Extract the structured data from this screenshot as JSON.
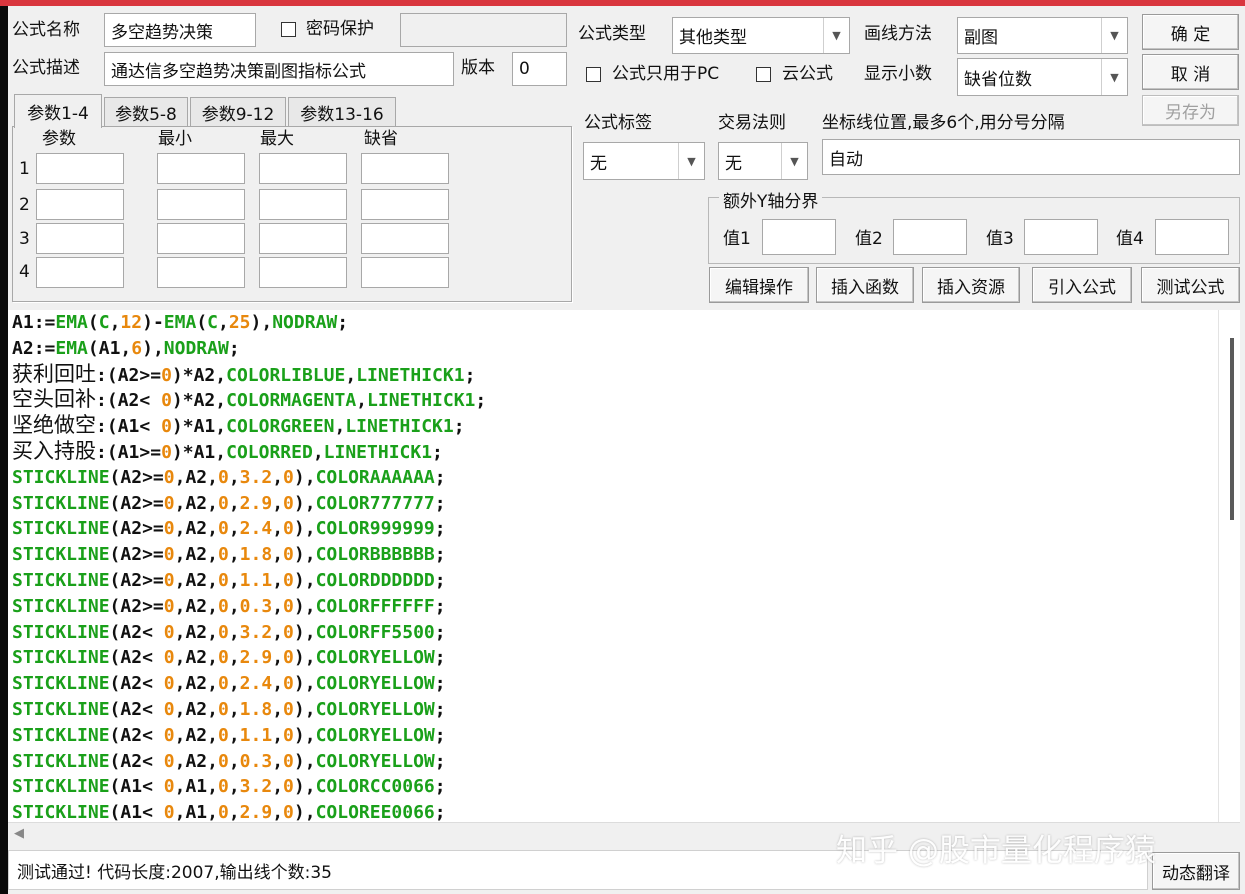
{
  "form": {
    "name_label": "公式名称",
    "name_value": "多空趋势决策",
    "password_label": "密码保护",
    "desc_label": "公式描述",
    "desc_value": "通达信多空趋势决策副图指标公式",
    "version_label": "版本",
    "version_value": "0",
    "type_label": "公式类型",
    "type_value": "其他类型",
    "draw_label": "画线方法",
    "draw_value": "副图",
    "pc_only_label": "公式只用于PC",
    "cloud_label": "云公式",
    "decimals_label": "显示小数",
    "decimals_value": "缺省位数",
    "tag_label": "公式标签",
    "tag_value": "无",
    "rule_label": "交易法则",
    "rule_value": "无",
    "axis_label": "坐标线位置,最多6个,用分号分隔",
    "axis_value": "自动",
    "yaxis_group": "额外Y轴分界",
    "y_labels": [
      "值1",
      "值2",
      "值3",
      "值4"
    ]
  },
  "buttons": {
    "ok": "确  定",
    "cancel": "取  消",
    "save_as": "另存为",
    "edit_ops": "编辑操作",
    "insert_func": "插入函数",
    "insert_res": "插入资源",
    "import_formula": "引入公式",
    "test_formula": "测试公式",
    "dynamic_translate": "动态翻译"
  },
  "tabs": [
    "参数1-4",
    "参数5-8",
    "参数9-12",
    "参数13-16"
  ],
  "params": {
    "headers": [
      "参数",
      "最小",
      "最大",
      "缺省"
    ],
    "rows": [
      "1",
      "2",
      "3",
      "4"
    ]
  },
  "code_lines": [
    "A1:=EMA(C,12)-EMA(C,25),NODRAW;",
    "A2:=EMA(A1,6),NODRAW;",
    "获利回吐:(A2>=0)*A2,COLORLIBLUE,LINETHICK1;",
    "空头回补:(A2< 0)*A2,COLORMAGENTA,LINETHICK1;",
    "坚绝做空:(A1< 0)*A1,COLORGREEN,LINETHICK1;",
    "买入持股:(A1>=0)*A1,COLORRED,LINETHICK1;",
    "STICKLINE(A2>=0,A2,0,3.2,0),COLORAAAAAA;",
    "STICKLINE(A2>=0,A2,0,2.9,0),COLOR777777;",
    "STICKLINE(A2>=0,A2,0,2.4,0),COLOR999999;",
    "STICKLINE(A2>=0,A2,0,1.8,0),COLORBBBBBB;",
    "STICKLINE(A2>=0,A2,0,1.1,0),COLORDDDDDD;",
    "STICKLINE(A2>=0,A2,0,0.3,0),COLORFFFFFF;",
    "STICKLINE(A2< 0,A2,0,3.2,0),COLORFF5500;",
    "STICKLINE(A2< 0,A2,0,2.9,0),COLORYELLOW;",
    "STICKLINE(A2< 0,A2,0,2.4,0),COLORYELLOW;",
    "STICKLINE(A2< 0,A2,0,1.8,0),COLORYELLOW;",
    "STICKLINE(A2< 0,A2,0,1.1,0),COLORYELLOW;",
    "STICKLINE(A2< 0,A2,0,0.3,0),COLORYELLOW;",
    "STICKLINE(A1< 0,A1,0,3.2,0),COLORCC0066;",
    "STICKLINE(A1< 0,A1,0,2.9,0),COLOREE0066;"
  ],
  "status_text": "测试通过! 代码长度:2007,输出线个数:35",
  "watermark": "知乎 @股市量化程序猿",
  "colors": {
    "keyword": "#111111",
    "function": "#1aa01a",
    "number": "#e8880d",
    "titlebar": "#d9363e"
  }
}
